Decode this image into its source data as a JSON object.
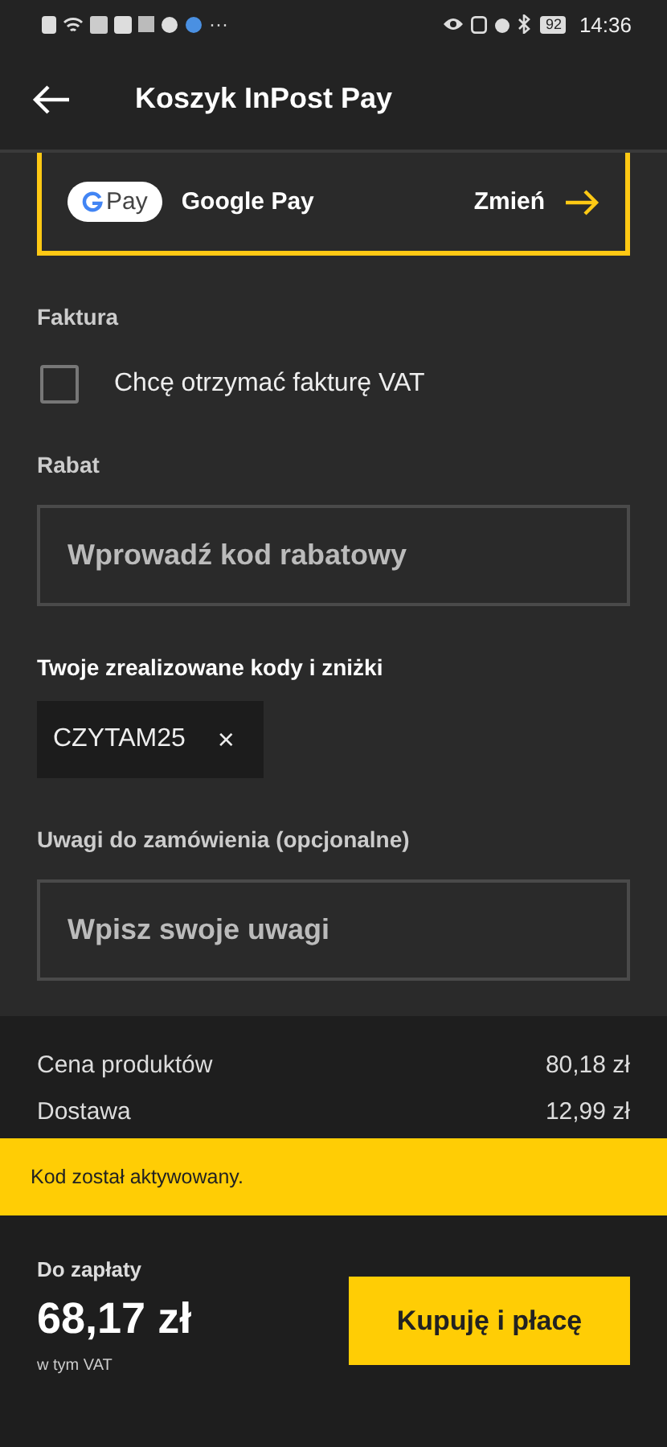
{
  "status_bar": {
    "more": "···",
    "battery": "92",
    "time": "14:36"
  },
  "header": {
    "title": "Koszyk InPost Pay"
  },
  "payment": {
    "badge": "Pay",
    "method": "Google Pay",
    "change": "Zmień"
  },
  "invoice": {
    "heading": "Faktura",
    "label": "Chcę otrzymać fakturę VAT",
    "checked": false
  },
  "discount": {
    "heading": "Rabat",
    "placeholder": "Wprowadź kod rabatowy"
  },
  "codes": {
    "heading": "Twoje zrealizowane kody i zniżki",
    "items": [
      {
        "code": "CZYTAM25",
        "remove": "×"
      }
    ]
  },
  "notes": {
    "heading": "Uwagi do zamówienia (opcjonalne)",
    "placeholder": "Wpisz swoje uwagi"
  },
  "summary": [
    {
      "label": "Cena produktów",
      "value": "80,18 zł"
    },
    {
      "label": "Dostawa",
      "value": "12,99 zł"
    }
  ],
  "toast": "Kod został aktywowany.",
  "footer": {
    "label": "Do zapłaty",
    "total": "68,17 zł",
    "note": "w tym VAT",
    "button": "Kupuję i płacę"
  }
}
